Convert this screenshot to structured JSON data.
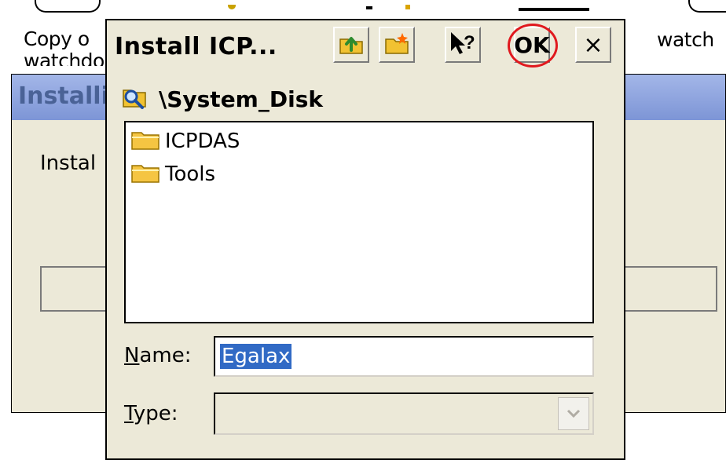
{
  "background": {
    "left_label": "Copy o",
    "left_label_line2": "watchdo",
    "right_label": "watch",
    "window_title": "Installi",
    "window_text": "Instal"
  },
  "dialog": {
    "title": "Install ICP...",
    "toolbar": {
      "up_icon": "folder-up-icon",
      "new_folder_icon": "new-folder-icon",
      "help_icon": "help-icon",
      "ok_label": "OK",
      "close_label": "×"
    },
    "path": {
      "icon": "folder-search-icon",
      "text": "\\System_Disk"
    },
    "files": [
      {
        "icon": "folder-icon",
        "label": "ICPDAS"
      },
      {
        "icon": "folder-icon",
        "label": "Tools"
      }
    ],
    "name_field": {
      "label_first": "N",
      "label_rest": "ame:",
      "value": "Egalax"
    },
    "type_field": {
      "label_first": "T",
      "label_rest": "ype:",
      "value": ""
    },
    "colors": {
      "highlight": "#e0191e",
      "selection": "#316ac5",
      "dialog_bg": "#ece9d8"
    }
  }
}
